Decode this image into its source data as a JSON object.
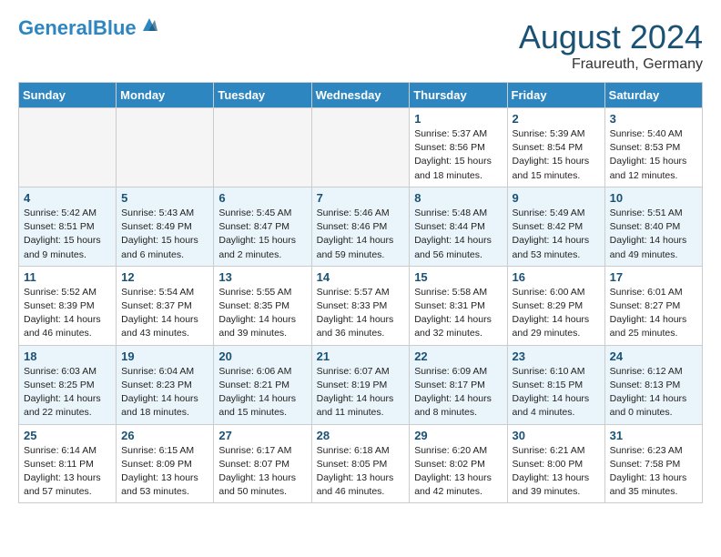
{
  "logo": {
    "text1": "General",
    "text2": "Blue"
  },
  "title": "August 2024",
  "location": "Fraureuth, Germany",
  "weekdays": [
    "Sunday",
    "Monday",
    "Tuesday",
    "Wednesday",
    "Thursday",
    "Friday",
    "Saturday"
  ],
  "weeks": [
    [
      {
        "day": "",
        "info": ""
      },
      {
        "day": "",
        "info": ""
      },
      {
        "day": "",
        "info": ""
      },
      {
        "day": "",
        "info": ""
      },
      {
        "day": "1",
        "info": "Sunrise: 5:37 AM\nSunset: 8:56 PM\nDaylight: 15 hours\nand 18 minutes."
      },
      {
        "day": "2",
        "info": "Sunrise: 5:39 AM\nSunset: 8:54 PM\nDaylight: 15 hours\nand 15 minutes."
      },
      {
        "day": "3",
        "info": "Sunrise: 5:40 AM\nSunset: 8:53 PM\nDaylight: 15 hours\nand 12 minutes."
      }
    ],
    [
      {
        "day": "4",
        "info": "Sunrise: 5:42 AM\nSunset: 8:51 PM\nDaylight: 15 hours\nand 9 minutes."
      },
      {
        "day": "5",
        "info": "Sunrise: 5:43 AM\nSunset: 8:49 PM\nDaylight: 15 hours\nand 6 minutes."
      },
      {
        "day": "6",
        "info": "Sunrise: 5:45 AM\nSunset: 8:47 PM\nDaylight: 15 hours\nand 2 minutes."
      },
      {
        "day": "7",
        "info": "Sunrise: 5:46 AM\nSunset: 8:46 PM\nDaylight: 14 hours\nand 59 minutes."
      },
      {
        "day": "8",
        "info": "Sunrise: 5:48 AM\nSunset: 8:44 PM\nDaylight: 14 hours\nand 56 minutes."
      },
      {
        "day": "9",
        "info": "Sunrise: 5:49 AM\nSunset: 8:42 PM\nDaylight: 14 hours\nand 53 minutes."
      },
      {
        "day": "10",
        "info": "Sunrise: 5:51 AM\nSunset: 8:40 PM\nDaylight: 14 hours\nand 49 minutes."
      }
    ],
    [
      {
        "day": "11",
        "info": "Sunrise: 5:52 AM\nSunset: 8:39 PM\nDaylight: 14 hours\nand 46 minutes."
      },
      {
        "day": "12",
        "info": "Sunrise: 5:54 AM\nSunset: 8:37 PM\nDaylight: 14 hours\nand 43 minutes."
      },
      {
        "day": "13",
        "info": "Sunrise: 5:55 AM\nSunset: 8:35 PM\nDaylight: 14 hours\nand 39 minutes."
      },
      {
        "day": "14",
        "info": "Sunrise: 5:57 AM\nSunset: 8:33 PM\nDaylight: 14 hours\nand 36 minutes."
      },
      {
        "day": "15",
        "info": "Sunrise: 5:58 AM\nSunset: 8:31 PM\nDaylight: 14 hours\nand 32 minutes."
      },
      {
        "day": "16",
        "info": "Sunrise: 6:00 AM\nSunset: 8:29 PM\nDaylight: 14 hours\nand 29 minutes."
      },
      {
        "day": "17",
        "info": "Sunrise: 6:01 AM\nSunset: 8:27 PM\nDaylight: 14 hours\nand 25 minutes."
      }
    ],
    [
      {
        "day": "18",
        "info": "Sunrise: 6:03 AM\nSunset: 8:25 PM\nDaylight: 14 hours\nand 22 minutes."
      },
      {
        "day": "19",
        "info": "Sunrise: 6:04 AM\nSunset: 8:23 PM\nDaylight: 14 hours\nand 18 minutes."
      },
      {
        "day": "20",
        "info": "Sunrise: 6:06 AM\nSunset: 8:21 PM\nDaylight: 14 hours\nand 15 minutes."
      },
      {
        "day": "21",
        "info": "Sunrise: 6:07 AM\nSunset: 8:19 PM\nDaylight: 14 hours\nand 11 minutes."
      },
      {
        "day": "22",
        "info": "Sunrise: 6:09 AM\nSunset: 8:17 PM\nDaylight: 14 hours\nand 8 minutes."
      },
      {
        "day": "23",
        "info": "Sunrise: 6:10 AM\nSunset: 8:15 PM\nDaylight: 14 hours\nand 4 minutes."
      },
      {
        "day": "24",
        "info": "Sunrise: 6:12 AM\nSunset: 8:13 PM\nDaylight: 14 hours\nand 0 minutes."
      }
    ],
    [
      {
        "day": "25",
        "info": "Sunrise: 6:14 AM\nSunset: 8:11 PM\nDaylight: 13 hours\nand 57 minutes."
      },
      {
        "day": "26",
        "info": "Sunrise: 6:15 AM\nSunset: 8:09 PM\nDaylight: 13 hours\nand 53 minutes."
      },
      {
        "day": "27",
        "info": "Sunrise: 6:17 AM\nSunset: 8:07 PM\nDaylight: 13 hours\nand 50 minutes."
      },
      {
        "day": "28",
        "info": "Sunrise: 6:18 AM\nSunset: 8:05 PM\nDaylight: 13 hours\nand 46 minutes."
      },
      {
        "day": "29",
        "info": "Sunrise: 6:20 AM\nSunset: 8:02 PM\nDaylight: 13 hours\nand 42 minutes."
      },
      {
        "day": "30",
        "info": "Sunrise: 6:21 AM\nSunset: 8:00 PM\nDaylight: 13 hours\nand 39 minutes."
      },
      {
        "day": "31",
        "info": "Sunrise: 6:23 AM\nSunset: 7:58 PM\nDaylight: 13 hours\nand 35 minutes."
      }
    ]
  ]
}
